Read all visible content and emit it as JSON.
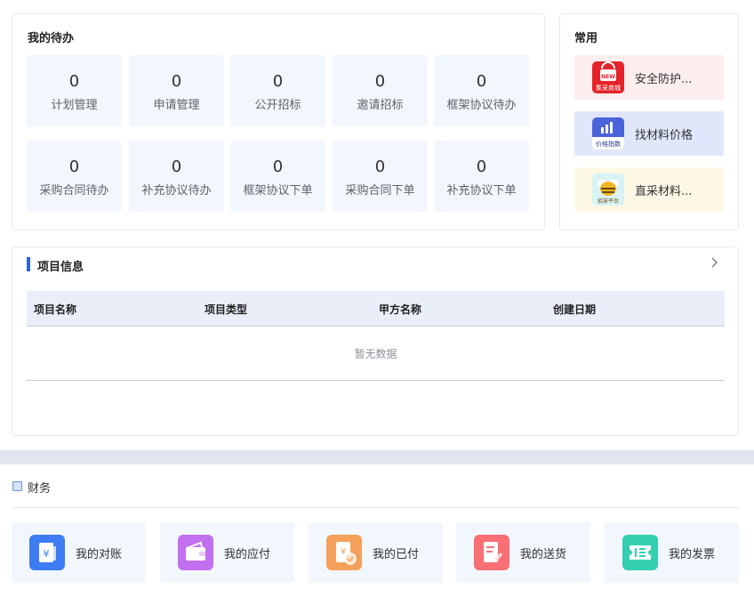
{
  "todo": {
    "title": "我的待办",
    "items": [
      {
        "count": "0",
        "label": "计划管理"
      },
      {
        "count": "0",
        "label": "申请管理"
      },
      {
        "count": "0",
        "label": "公开招标"
      },
      {
        "count": "0",
        "label": "邀请招标"
      },
      {
        "count": "0",
        "label": "框架协议待办"
      },
      {
        "count": "0",
        "label": "采购合同待办"
      },
      {
        "count": "0",
        "label": "补充协议待办"
      },
      {
        "count": "0",
        "label": "框架协议下单"
      },
      {
        "count": "0",
        "label": "采购合同下单"
      },
      {
        "count": "0",
        "label": "补充协议下单"
      }
    ]
  },
  "common": {
    "title": "常用",
    "apps": [
      {
        "label": "安全防护...",
        "icon": "mall-bag-icon",
        "icon_text_top": "NEW",
        "icon_text_bottom": "集采商城",
        "bg": "#fdeeee"
      },
      {
        "label": "找材料价格",
        "icon": "price-chart-icon",
        "icon_text": "价格指数",
        "bg": "#e1e7fb"
      },
      {
        "label": "直采材料...",
        "icon": "bee-icon",
        "icon_text": "招采平台",
        "bg": "#fdf8e6"
      }
    ]
  },
  "project": {
    "title": "项目信息",
    "columns": [
      "项目名称",
      "项目类型",
      "甲方名称",
      "创建日期"
    ],
    "rows": [],
    "empty_text": "暂无数据"
  },
  "finance": {
    "title": "财务",
    "items": [
      {
        "label": "我的对账",
        "icon": "reconcile-icon",
        "color": "#3d7cf2"
      },
      {
        "label": "我的应付",
        "icon": "wallet-icon",
        "color": "#c270f0"
      },
      {
        "label": "我的已付",
        "icon": "paid-icon",
        "color": "#f5a05a"
      },
      {
        "label": "我的送货",
        "icon": "delivery-icon",
        "color": "#f86f74"
      },
      {
        "label": "我的发票",
        "icon": "invoice-icon",
        "color": "#33cfb0"
      }
    ]
  }
}
